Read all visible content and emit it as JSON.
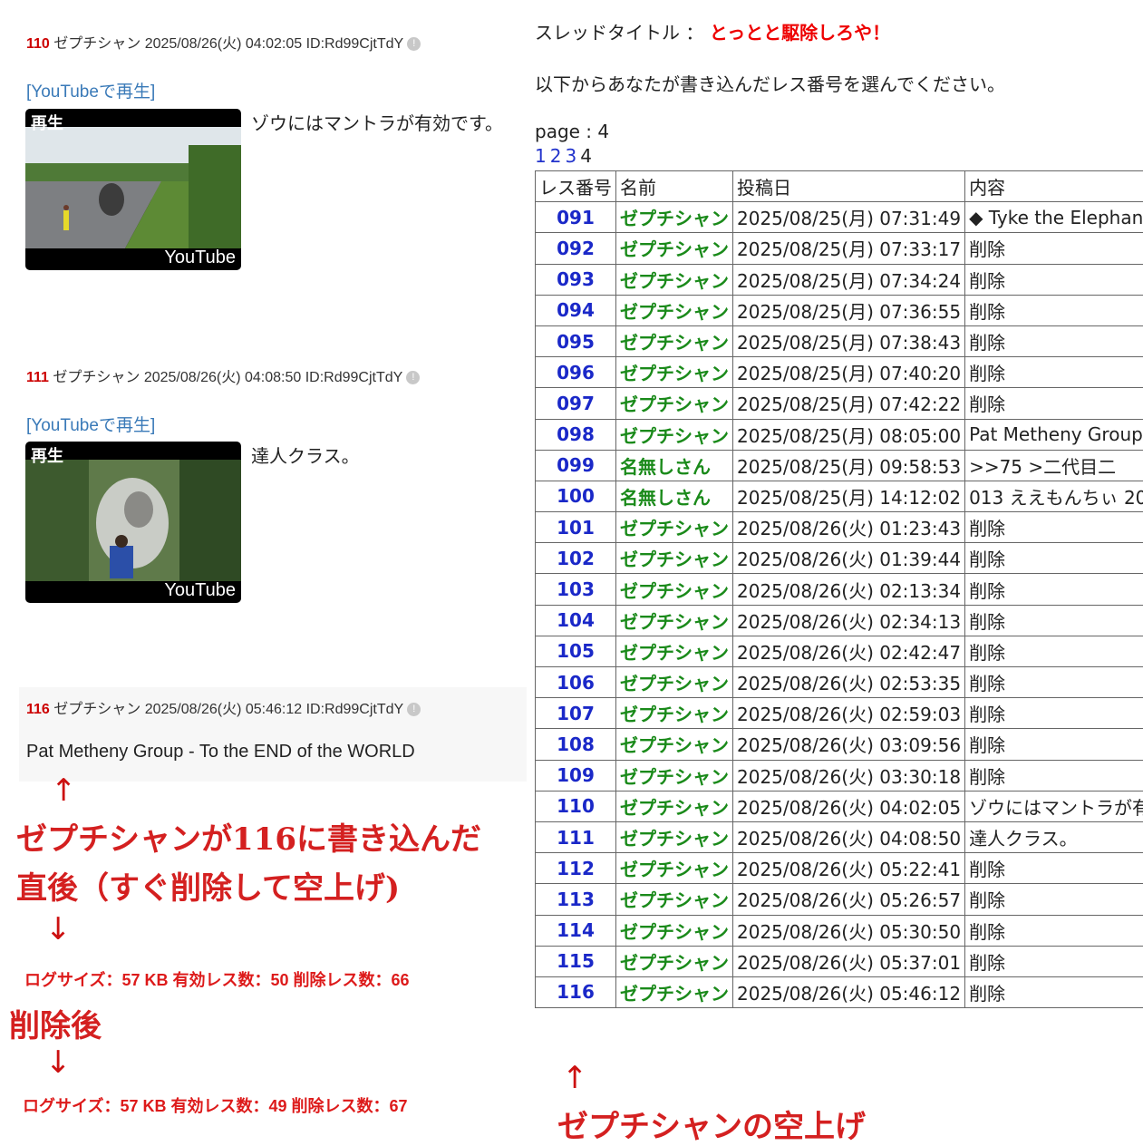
{
  "left_posts": [
    {
      "num": "110",
      "header": " ゼプチシャン 2025/08/26(火) 04:02:05 ID:Rd99CjtTdY",
      "link": "[YouTubeで再生]",
      "thumb_label": "再生",
      "thumb_brand": "YouTube",
      "body": "ゾウにはマントラが有効です。"
    },
    {
      "num": "111",
      "header": " ゼプチシャン 2025/08/26(火) 04:08:50 ID:Rd99CjtTdY",
      "link": "[YouTubeで再生]",
      "thumb_label": "再生",
      "thumb_brand": "YouTube",
      "body": "達人クラス。"
    },
    {
      "num": "116",
      "header": " ゼプチシャン 2025/08/26(火) 05:46:12 ID:Rd99CjtTdY",
      "body": "Pat Metheny Group - To the END of the WORLD"
    }
  ],
  "annotations": {
    "arrow_up": "↑",
    "arrow_down": "↓",
    "note_line1": "ゼプチシャンが116に書き込んだ",
    "note_line2": "直後（すぐ削除して空上げ)",
    "log_before": "ログサイズ：57 KB 有効レス数：50 削除レス数：66",
    "after_label": "削除後",
    "log_after": "ログサイズ：57 KB 有効レス数：49 削除レス数：67",
    "table_note": "ゼプチシャンの空上げ"
  },
  "thread": {
    "title_label": "スレッドタイトル ： ",
    "title": "とっとと駆除しろや！",
    "instruction": "以下からあなたが書き込んだレス番号を選んでください。",
    "page_label": "page : 4",
    "pages": [
      "1",
      "2",
      "3"
    ],
    "current_page": "4"
  },
  "table": {
    "headers": [
      "レス番号",
      "名前",
      "投稿日",
      "内容"
    ],
    "rows": [
      [
        "091",
        "ゼプチシャン",
        "2025/08/25(月) 07:31:49",
        "◆ Tyke the Elephant"
      ],
      [
        "092",
        "ゼプチシャン",
        "2025/08/25(月) 07:33:17",
        "削除"
      ],
      [
        "093",
        "ゼプチシャン",
        "2025/08/25(月) 07:34:24",
        "削除"
      ],
      [
        "094",
        "ゼプチシャン",
        "2025/08/25(月) 07:36:55",
        "削除"
      ],
      [
        "095",
        "ゼプチシャン",
        "2025/08/25(月) 07:38:43",
        "削除"
      ],
      [
        "096",
        "ゼプチシャン",
        "2025/08/25(月) 07:40:20",
        "削除"
      ],
      [
        "097",
        "ゼプチシャン",
        "2025/08/25(月) 07:42:22",
        "削除"
      ],
      [
        "098",
        "ゼプチシャン",
        "2025/08/25(月) 08:05:00",
        "Pat Metheny Group"
      ],
      [
        "099",
        "名無しさん",
        "2025/08/25(月) 09:58:53",
        ">>75 >二代目二"
      ],
      [
        "100",
        "名無しさん",
        "2025/08/25(月) 14:12:02",
        "013 ええもんちぃ 20"
      ],
      [
        "101",
        "ゼプチシャン",
        "2025/08/26(火) 01:23:43",
        "削除"
      ],
      [
        "102",
        "ゼプチシャン",
        "2025/08/26(火) 01:39:44",
        "削除"
      ],
      [
        "103",
        "ゼプチシャン",
        "2025/08/26(火) 02:13:34",
        "削除"
      ],
      [
        "104",
        "ゼプチシャン",
        "2025/08/26(火) 02:34:13",
        "削除"
      ],
      [
        "105",
        "ゼプチシャン",
        "2025/08/26(火) 02:42:47",
        "削除"
      ],
      [
        "106",
        "ゼプチシャン",
        "2025/08/26(火) 02:53:35",
        "削除"
      ],
      [
        "107",
        "ゼプチシャン",
        "2025/08/26(火) 02:59:03",
        "削除"
      ],
      [
        "108",
        "ゼプチシャン",
        "2025/08/26(火) 03:09:56",
        "削除"
      ],
      [
        "109",
        "ゼプチシャン",
        "2025/08/26(火) 03:30:18",
        "削除"
      ],
      [
        "110",
        "ゼプチシャン",
        "2025/08/26(火) 04:02:05",
        "ゾウにはマントラが有"
      ],
      [
        "111",
        "ゼプチシャン",
        "2025/08/26(火) 04:08:50",
        "達人クラス。"
      ],
      [
        "112",
        "ゼプチシャン",
        "2025/08/26(火) 05:22:41",
        "削除"
      ],
      [
        "113",
        "ゼプチシャン",
        "2025/08/26(火) 05:26:57",
        "削除"
      ],
      [
        "114",
        "ゼプチシャン",
        "2025/08/26(火) 05:30:50",
        "削除"
      ],
      [
        "115",
        "ゼプチシャン",
        "2025/08/26(火) 05:37:01",
        "削除"
      ],
      [
        "116",
        "ゼプチシャン",
        "2025/08/26(火) 05:46:12",
        "削除"
      ]
    ]
  }
}
